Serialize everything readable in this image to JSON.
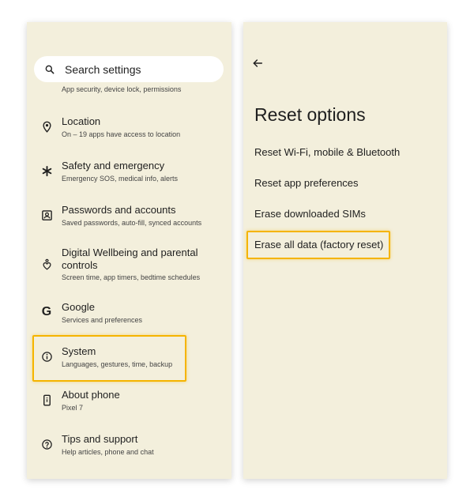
{
  "settings": {
    "search_placeholder": "Search settings",
    "cut_off_subtitle": "App security, device lock, permissions",
    "items": [
      {
        "icon": "location-pin-icon",
        "title": "Location",
        "subtitle": "On – 19 apps have access to location"
      },
      {
        "icon": "asterisk-icon",
        "title": "Safety and emergency",
        "subtitle": "Emergency SOS, medical info, alerts"
      },
      {
        "icon": "account-box-icon",
        "title": "Passwords and accounts",
        "subtitle": "Saved passwords, auto-fill, synced accounts"
      },
      {
        "icon": "wellbeing-icon",
        "title": "Digital Wellbeing and parental controls",
        "subtitle": "Screen time, app timers, bedtime schedules"
      },
      {
        "icon": "google-g-icon",
        "title": "Google",
        "subtitle": "Services and preferences"
      },
      {
        "icon": "info-icon",
        "title": "System",
        "subtitle": "Languages, gestures, time, backup"
      },
      {
        "icon": "phone-icon",
        "title": "About phone",
        "subtitle": "Pixel 7"
      },
      {
        "icon": "help-icon",
        "title": "Tips and support",
        "subtitle": "Help articles, phone and chat"
      }
    ]
  },
  "reset": {
    "title": "Reset options",
    "options": [
      "Reset Wi-Fi, mobile & Bluetooth",
      "Reset app preferences",
      "Erase downloaded SIMs",
      "Erase all data (factory reset)"
    ]
  },
  "colors": {
    "panel_bg": "#f3efdc",
    "highlight": "#f5b400",
    "text": "#1f1f1f"
  }
}
